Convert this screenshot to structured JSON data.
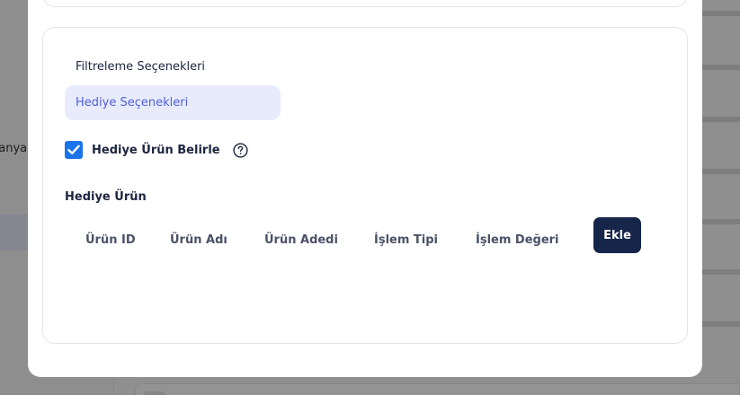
{
  "background": {
    "left_label": "banya"
  },
  "modal": {
    "filter_section": {
      "title": "Filtreleme Seçenekleri",
      "selected_option": "Hediye Seçenekleri"
    },
    "gift_checkbox": {
      "label": "Hediye Ürün Belirle",
      "checked": true,
      "help_icon": "question-circle-icon"
    },
    "gift_product": {
      "title": "Hediye Ürün",
      "columns": [
        "Ürün ID",
        "Ürün Adı",
        "Ürün Adedi",
        "İşlem Tipi",
        "İşlem Değeri"
      ],
      "add_button": "Ekle"
    }
  },
  "colors": {
    "accent": "#1a73e8",
    "primary_button": "#16264a",
    "pill_bg": "#e8ebfc",
    "pill_text": "#4f60d8"
  }
}
